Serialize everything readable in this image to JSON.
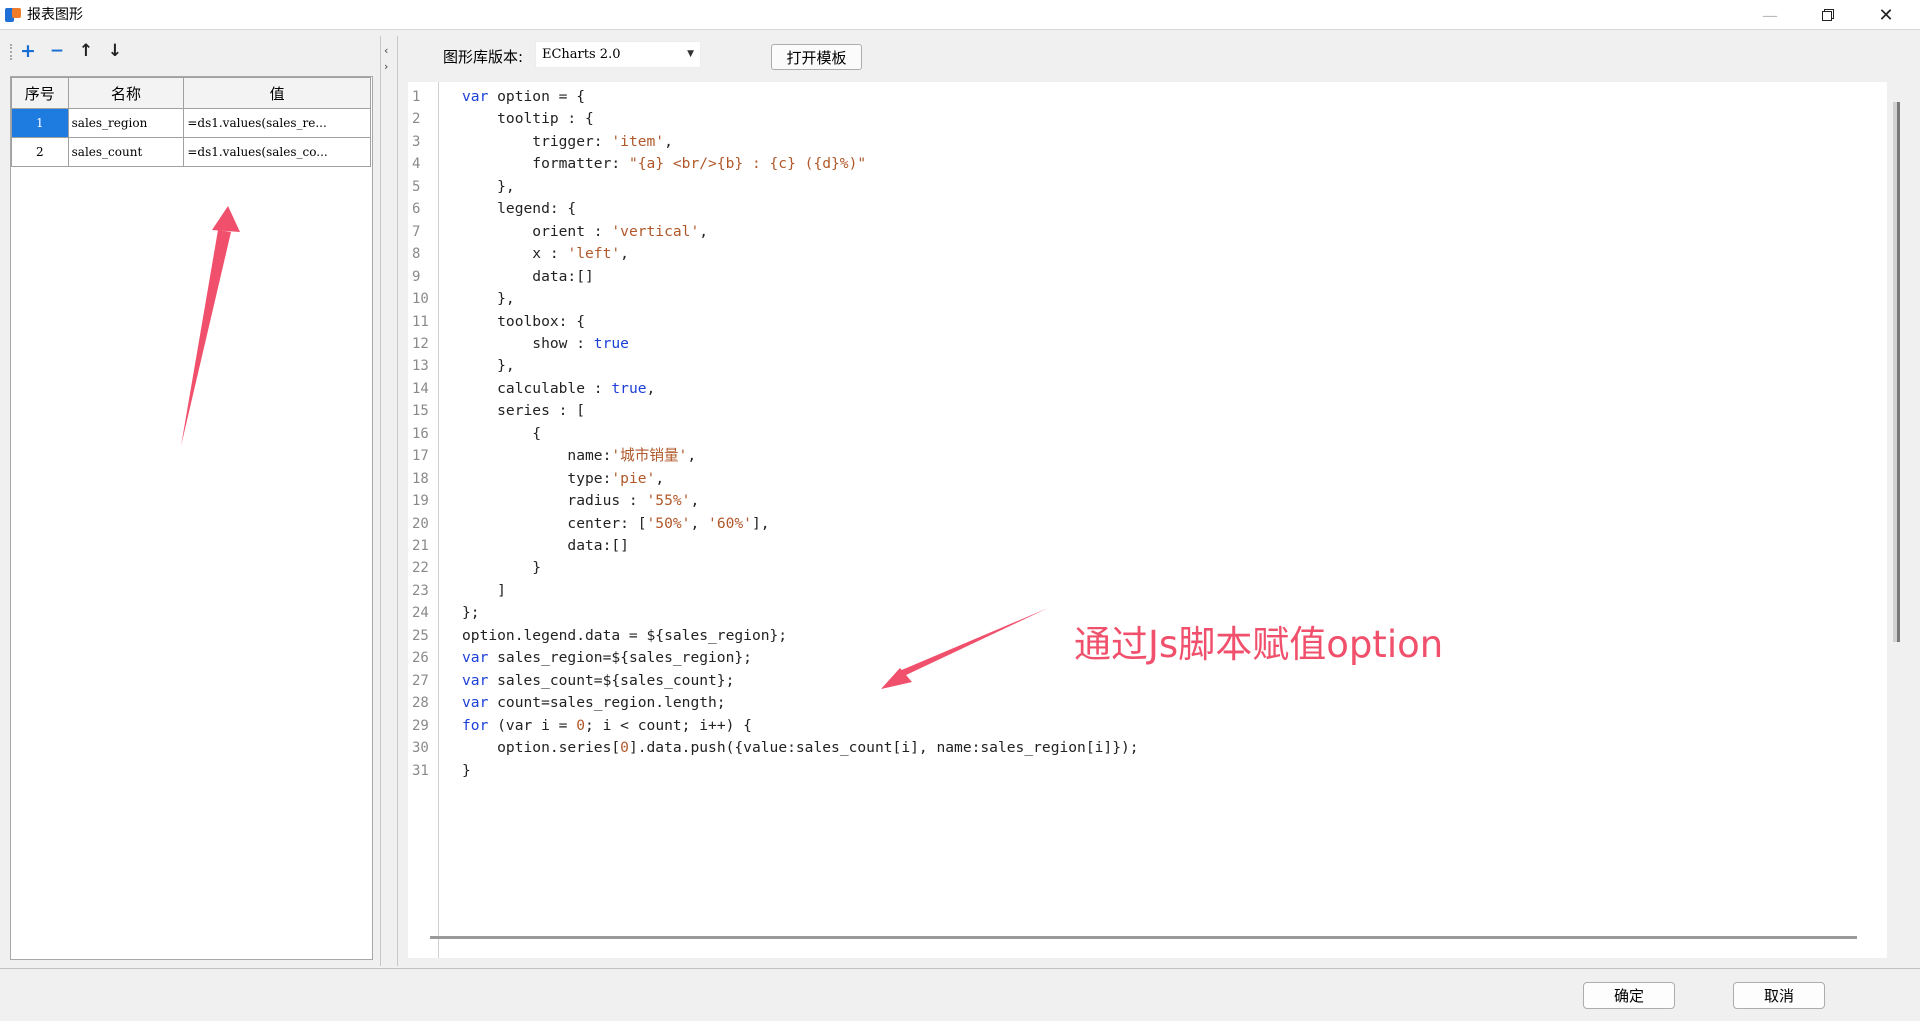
{
  "window": {
    "title": "报表图形"
  },
  "toolbar": {
    "add_icon": "plus-icon",
    "remove_icon": "minus-icon",
    "up_icon": "arrow-up-icon",
    "down_icon": "arrow-down-icon"
  },
  "params_table": {
    "headers": [
      "序号",
      "名称",
      "值"
    ],
    "rows": [
      {
        "index": "1",
        "name": "sales_region",
        "value": "=ds1.values(sales_re..."
      },
      {
        "index": "2",
        "name": "sales_count",
        "value": "=ds1.values(sales_co..."
      }
    ]
  },
  "chart_lib": {
    "label": "图形库版本:",
    "selected": "ECharts 2.0",
    "open_template": "打开模板"
  },
  "annotation": {
    "text": "通过Js脚本赋值option",
    "color": "#f0506b"
  },
  "code_lines": [
    "<k>var</k> option = {",
    "    tooltip : {",
    "        trigger: <s>'item'</s>,",
    "        formatter: <s>\"{a} &lt;br/&gt;{b} : {c} ({d}%)\"</s>",
    "    },",
    "    legend: {",
    "        orient : <s>'vertical'</s>,",
    "        x : <s>'left'</s>,",
    "        data:[]",
    "    },",
    "    toolbox: {",
    "        show : <k>true</k>",
    "    },",
    "    calculable : <k>true</k>,",
    "    series : [",
    "        {",
    "            name:<s>'城市销量'</s>,",
    "            type:<s>'pie'</s>,",
    "            radius : <s>'55%'</s>,",
    "            center: [<s>'50%'</s>, <s>'60%'</s>],",
    "            data:[]",
    "        }",
    "    ]",
    "};",
    "option.legend.data = ${sales_region};",
    "<k>var</k> sales_region=${sales_region};",
    "<k>var</k> sales_count=${sales_count};",
    "<k>var</k> count=sales_region.length;",
    "<k>for</k> (var i = <s>0</s>; i &lt; count; i++) {",
    "    option.series[<s>0</s>].data.push({value:sales_count[i], name:sales_region[i]});",
    "}"
  ],
  "footer": {
    "ok": "确定",
    "cancel": "取消"
  }
}
